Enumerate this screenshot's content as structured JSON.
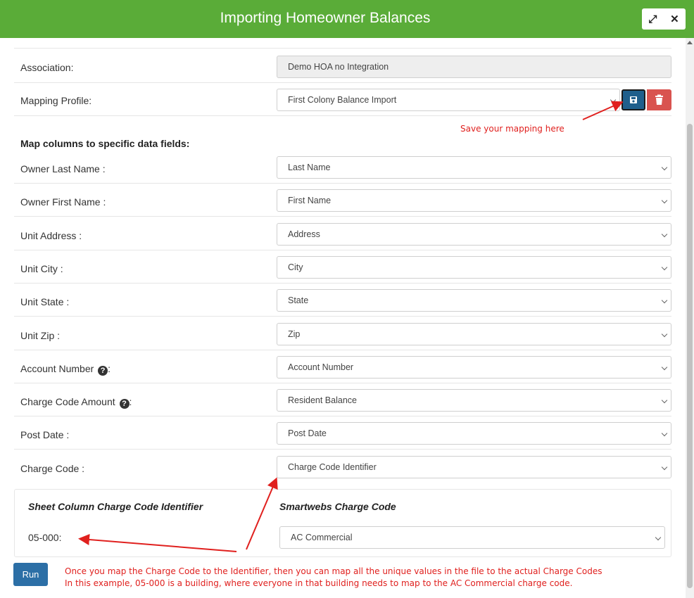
{
  "header": {
    "title": "Importing Homeowner Balances",
    "expand_icon": "⤢",
    "close_icon": "✕"
  },
  "association": {
    "label": "Association:",
    "value": "Demo HOA no Integration"
  },
  "mapping_profile": {
    "label": "Mapping Profile:",
    "value": "First Colony Balance Import"
  },
  "annotations": {
    "save_hint": "Save your mapping here",
    "bottom_line1": "Once you map the Charge Code to the Identifier, then you can map all the unique values in the file to the actual Charge Codes",
    "bottom_line2": "In this example, 05-000 is a building, where everyone in that building needs to map to the AC Commercial charge code."
  },
  "section_title": "Map columns to specific data fields:",
  "fields": [
    {
      "label": "Owner Last Name :",
      "value": "Last Name",
      "help": false
    },
    {
      "label": "Owner First Name :",
      "value": "First Name",
      "help": false
    },
    {
      "label": "Unit Address :",
      "value": "Address",
      "help": false
    },
    {
      "label": "Unit City :",
      "value": "City",
      "help": false
    },
    {
      "label": "Unit State :",
      "value": "State",
      "help": false
    },
    {
      "label": "Unit Zip :",
      "value": "Zip",
      "help": false
    },
    {
      "label": "Account Number ",
      "suffix": ":",
      "value": "Account Number",
      "help": true
    },
    {
      "label": "Charge Code Amount ",
      "suffix": ":",
      "value": "Resident Balance",
      "help": true
    },
    {
      "label": "Post Date :",
      "value": "Post Date",
      "help": false
    },
    {
      "label": "Charge Code :",
      "value": "Charge Code Identifier",
      "help": false
    }
  ],
  "mapping_panel": {
    "col1_header": "Sheet Column Charge Code Identifier",
    "col2_header": "Smartwebs Charge Code",
    "identifier": "05-000:",
    "charge_code": "AC Commercial"
  },
  "run_label": "Run",
  "colors": {
    "header": "#5aac38",
    "save_button": "#1f5f8c",
    "delete_button": "#d9534f",
    "run_button": "#2c6fa6",
    "annotation": "#e0201e"
  }
}
